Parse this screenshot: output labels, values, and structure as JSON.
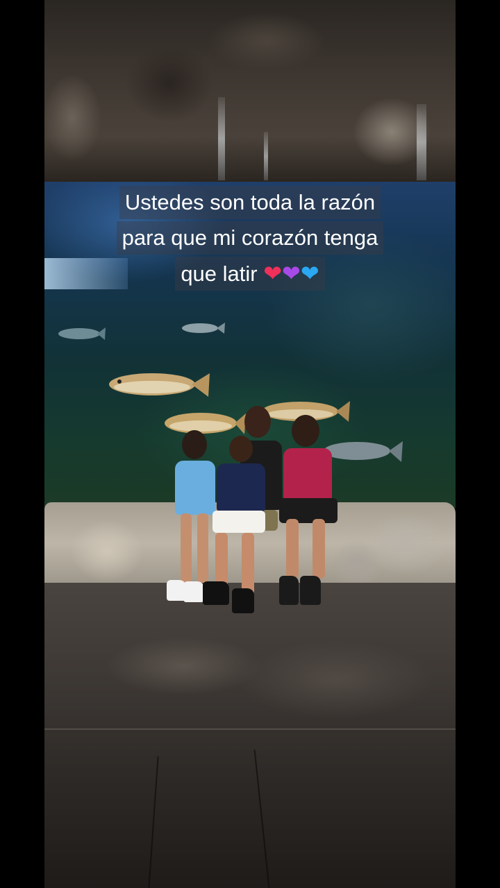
{
  "caption": {
    "line1": "Ustedes son toda la razón",
    "line2": "para que mi corazón tenga",
    "line3_text": "que latir",
    "hearts": [
      {
        "glyph": "❤",
        "color": "#f0305a",
        "icon": "red-heart-icon"
      },
      {
        "glyph": "❤",
        "color": "#a84ae8",
        "icon": "purple-heart-icon"
      },
      {
        "glyph": "❤",
        "color": "#2aa8f2",
        "icon": "blue-heart-icon"
      }
    ]
  },
  "colors": {
    "background": "#000000",
    "caption_text": "#ffffff",
    "caption_box": "rgba(60,60,70,0.42)"
  }
}
